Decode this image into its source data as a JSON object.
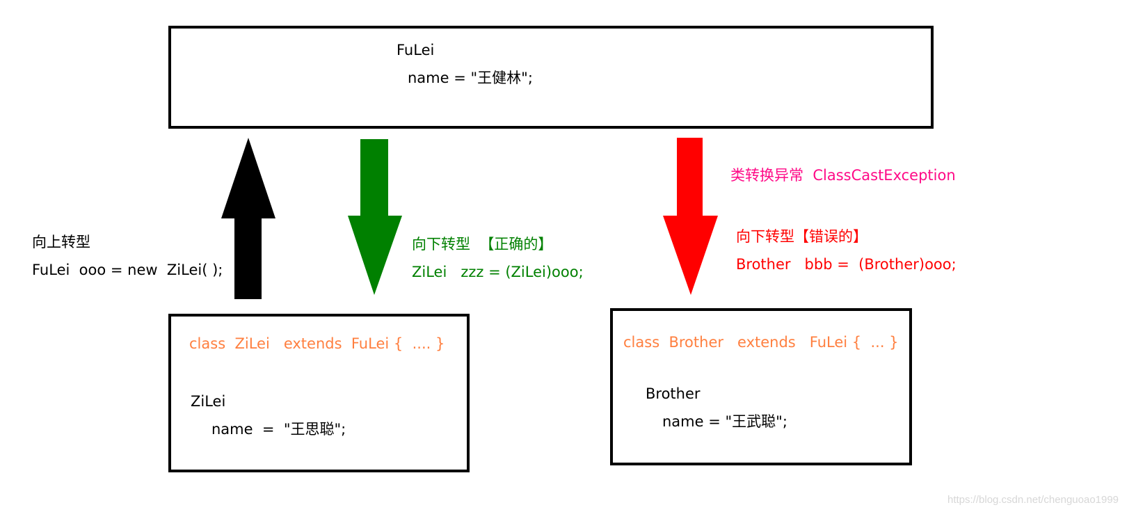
{
  "parent_box": {
    "class_name": "FuLei",
    "field_line": "name = \"王健林\";"
  },
  "upcast": {
    "title": "向上转型",
    "code": "FuLei  ooo = new  ZiLei( );",
    "arrow_color": "#000000",
    "arrow_direction": "up"
  },
  "downcast_correct": {
    "title": "向下转型  【正确的】",
    "code": "ZiLei   zzz = (ZiLei)ooo;",
    "arrow_color": "#008000",
    "arrow_direction": "down"
  },
  "downcast_wrong": {
    "exception": "类转换异常  ClassCastException",
    "title": "向下转型【错误的】",
    "code": "Brother   bbb =  (Brother)ooo;",
    "arrow_color": "#ff0000",
    "exception_color": "#ff0a87",
    "arrow_direction": "down"
  },
  "child_box": {
    "declaration": "class  ZiLei   extends  FuLei {  .... }",
    "class_name": "ZiLei",
    "field_line": "name  =  \"王思聪\";"
  },
  "brother_box": {
    "declaration": "class  Brother   extends   FuLei {  ... }",
    "class_name": "Brother",
    "field_line": "name = \"王武聪\";"
  },
  "watermark": "https://blog.csdn.net/chenguoao1999"
}
